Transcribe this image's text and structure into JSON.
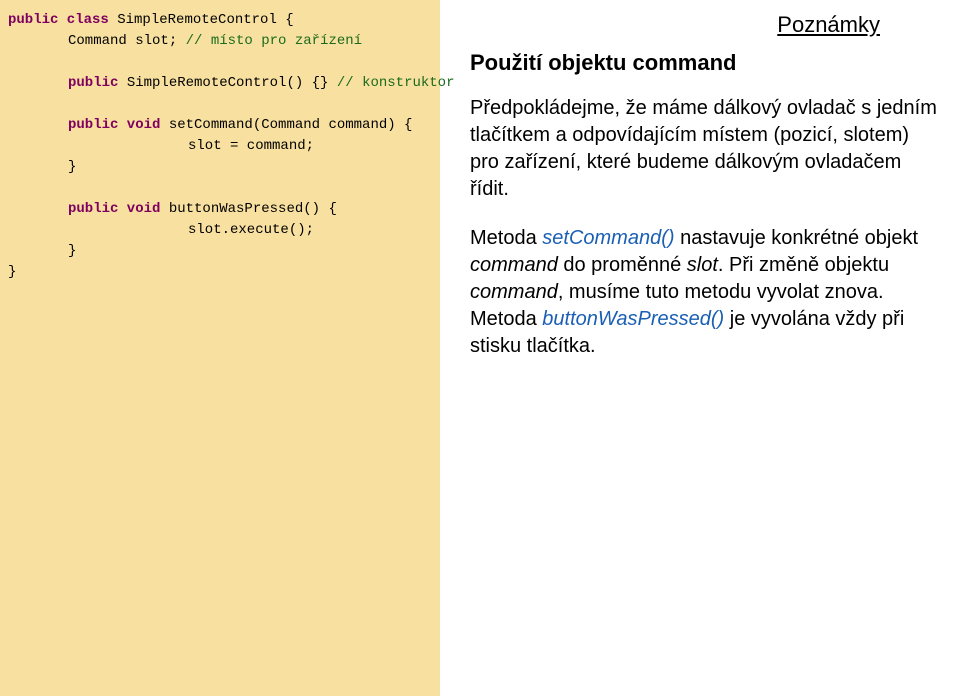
{
  "code": {
    "l1": {
      "kw": "public class",
      "rest": " SimpleRemoteControl {"
    },
    "l2": {
      "pre": "Command slot; ",
      "comment": "// místo pro zařízení"
    },
    "l3": {
      "kw": "public",
      "mid": " SimpleRemoteControl() {} ",
      "comment": "// konstruktor"
    },
    "l4": {
      "kw": "public void",
      "rest": " setCommand(Command command) {"
    },
    "l5": "slot = command;",
    "l6": "}",
    "l7": {
      "kw": "public void",
      "rest": " buttonWasPressed() {"
    },
    "l8": "slot.execute();",
    "l9": "}",
    "l10": "}"
  },
  "notes": {
    "title": "Poznámky",
    "heading": "Použití objektu command",
    "p1": "Předpokládejme, že máme dálkový ovladač s jedním tlačítkem a odpovídajícím místem (pozicí, slotem) pro zařízení, které budeme dálkovým ovladačem řídit.",
    "p2a": " Metoda ",
    "p2b": "setCommand()",
    "p2c": " nastavuje konkrétné objekt ",
    "p2d": "command",
    "p2e": " do proměnné ",
    "p2f": "slot",
    "p2g": ". Při změně objektu ",
    "p2h": "command",
    "p2i": ", musíme tuto metodu vyvolat znova.",
    "p3a": "Metoda ",
    "p3b": "buttonWasPressed()",
    "p3c": " je vyvolána vždy při stisku tlačítka."
  }
}
